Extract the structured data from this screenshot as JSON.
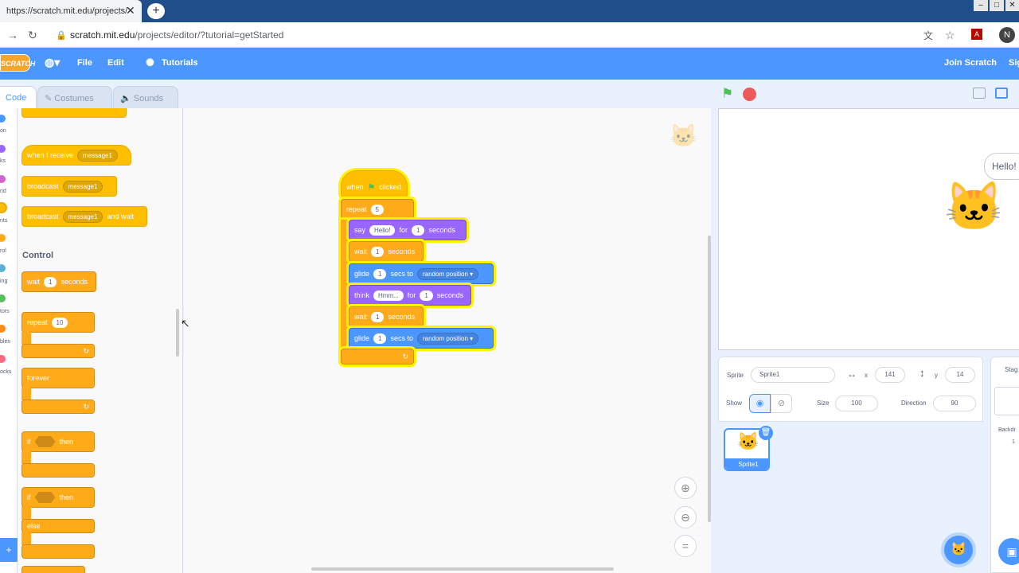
{
  "browser": {
    "tab_title": "https://scratch.mit.edu/projects/",
    "tab_close": "✕",
    "new_tab": "+",
    "url_host": "scratch.mit.edu",
    "url_path": "/projects/editor/?tutorial=getStarted",
    "avatar_letter": "N"
  },
  "menu": {
    "logo": "SCRATCH",
    "file": "File",
    "edit": "Edit",
    "tutorials": "Tutorials",
    "join": "Join Scratch",
    "sign": "Sig"
  },
  "tabs": {
    "code": "Code",
    "costumes": "Costumes",
    "sounds": "Sounds"
  },
  "categories": [
    {
      "label": "on",
      "color": "#4c97ff"
    },
    {
      "label": "ks",
      "color": "#9966ff"
    },
    {
      "label": "nd",
      "color": "#cf63cf"
    },
    {
      "label": "nts",
      "color": "#ffbf00"
    },
    {
      "label": "rol",
      "color": "#ffab19"
    },
    {
      "label": "ing",
      "color": "#5cb1d6"
    },
    {
      "label": "tors",
      "color": "#59c059"
    },
    {
      "label": "bles",
      "color": "#ff8c1a"
    },
    {
      "label": "ocks",
      "color": "#ff6680"
    }
  ],
  "palette": {
    "when_receive": "when I receive",
    "message1": "message1",
    "broadcast": "broadcast",
    "and_wait": "and wait",
    "control_heading": "Control",
    "wait": "wait",
    "wait_val": "1",
    "seconds": "seconds",
    "repeat": "repeat",
    "repeat_val": "10",
    "forever": "forever",
    "if": "if",
    "then": "then",
    "else": "else"
  },
  "script": {
    "when": "when",
    "clicked": "clicked",
    "repeat": "repeat",
    "repeat_val": "5",
    "say": "say",
    "say_text": "Hello!",
    "for": "for",
    "say_secs": "1",
    "seconds": "seconds",
    "wait": "wait",
    "wait1": "1",
    "glide": "glide",
    "glide1": "1",
    "secs_to": "secs to",
    "random_position": "random position",
    "think": "think",
    "think_text": "Hmm...",
    "think_secs": "1",
    "wait2": "1",
    "glide2": "1"
  },
  "stage": {
    "speech": "Hello!"
  },
  "sprite_info": {
    "sprite_label": "Sprite",
    "sprite_name": "Sprite1",
    "x_label": "x",
    "x_val": "141",
    "y_label": "y",
    "y_val": "14",
    "show_label": "Show",
    "size_label": "Size",
    "size_val": "100",
    "direction_label": "Direction",
    "direction_val": "90",
    "thumb_name": "Sprite1"
  },
  "stage_pane": {
    "title": "Stag",
    "backdrops": "Backdr",
    "count": "1"
  },
  "colors": {
    "scratch_blue": "#4c97ff",
    "events": "#ffbf00",
    "control": "#ffab19",
    "looks": "#9966ff",
    "motion": "#4c97ff"
  }
}
